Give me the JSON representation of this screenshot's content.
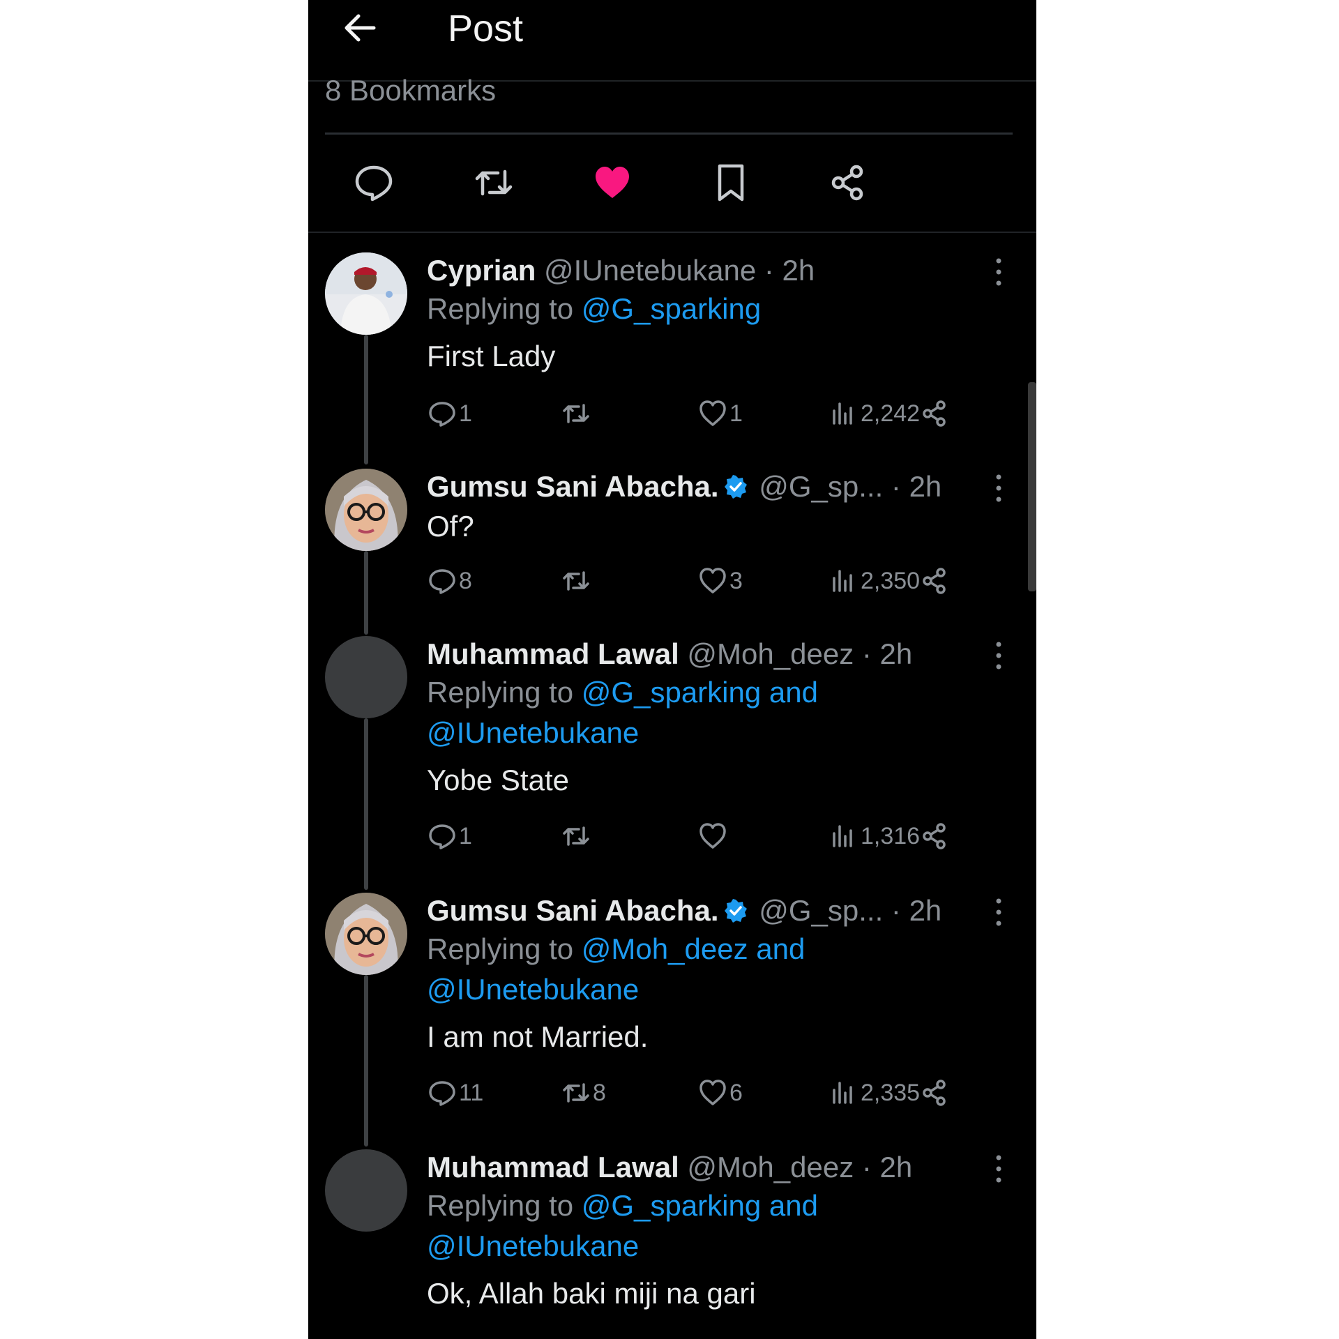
{
  "header": {
    "title": "Post"
  },
  "post": {
    "bookmarks_text": "8 Bookmarks",
    "liked": true
  },
  "colors": {
    "accent": "#1d9bf0",
    "like": "#f91880",
    "background": "#000000",
    "muted": "#8b9096"
  },
  "tweets": [
    {
      "name": "Cyprian",
      "handle": "@IUnetebukane",
      "time": "· 2h",
      "verified": false,
      "replying_prefix": "Replying to ",
      "replying_to": "@G_sparking",
      "text": "First Lady",
      "stats": {
        "replies": "1",
        "retweets": "",
        "likes": "1",
        "views": "2,242"
      },
      "avatar": "photo-man"
    },
    {
      "name": "Gumsu Sani Abacha.",
      "handle": "@G_sp...",
      "time": "· 2h",
      "verified": true,
      "text": "Of?",
      "stats": {
        "replies": "8",
        "retweets": "",
        "likes": "3",
        "views": "2,350"
      },
      "avatar": "photo-woman"
    },
    {
      "name": "Muhammad Lawal",
      "handle": "@Moh_deez",
      "time": "· 2h",
      "verified": false,
      "replying_prefix": "Replying to ",
      "replying_to": "@G_sparking and",
      "replying_to_2": "@IUnetebukane",
      "text": "Yobe State",
      "stats": {
        "replies": "1",
        "retweets": "",
        "likes": "",
        "views": "1,316"
      },
      "avatar": "blank"
    },
    {
      "name": "Gumsu Sani Abacha.",
      "handle": "@G_sp...",
      "time": "· 2h",
      "verified": true,
      "replying_prefix": "Replying to ",
      "replying_to": "@Moh_deez and",
      "replying_to_2": "@IUnetebukane",
      "text": "I am not Married.",
      "stats": {
        "replies": "11",
        "retweets": "8",
        "likes": "6",
        "views": "2,335"
      },
      "avatar": "photo-woman"
    },
    {
      "name": "Muhammad Lawal",
      "handle": "@Moh_deez",
      "time": "· 2h",
      "verified": false,
      "replying_prefix": "Replying to ",
      "replying_to": "@G_sparking and",
      "replying_to_2": "@IUnetebukane",
      "text": "Ok, Allah baki miji na gari",
      "avatar": "blank"
    }
  ]
}
